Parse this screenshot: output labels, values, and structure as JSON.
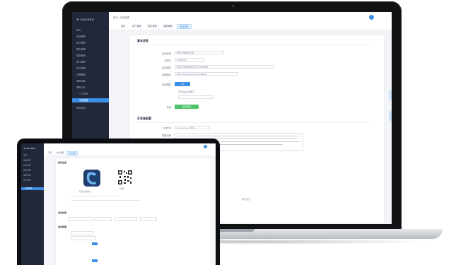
{
  "main_app": {
    "logo_text": "▼ GUOSEN",
    "sidebar": {
      "items": [
        "首页",
        "系统管理",
        "用户管理",
        "角色管理",
        "菜单管理",
        "部门管理",
        "岗位管理",
        "字典管理",
        "参数设置",
        "通知公告"
      ],
      "sub_items": [
        "日志管理"
      ],
      "active_item": "应用管理",
      "after_items": [
        "系统监控"
      ]
    },
    "breadcrumb": "首页 / 应用管理",
    "tabs": [
      {
        "label": "首页"
      },
      {
        "label": "用户管理"
      },
      {
        "label": "角色管理"
      },
      {
        "label": "菜单管理"
      },
      {
        "label": "应用配置"
      }
    ],
    "form": {
      "section1_title": "基本信息",
      "fields": [
        {
          "label": "应用名称",
          "value": "国信证券移动应用"
        },
        {
          "label": "应用ID",
          "value": "10000001"
        },
        {
          "label": "应用描述",
          "value": "国信证券移动端应用平台集成服务"
        },
        {
          "label": "回调地址",
          "value": "https://app.guosen.com/callback"
        }
      ],
      "upload_label": "应用图标",
      "upload_button": "上传",
      "upload_hint": "支持jpg/png格式",
      "status_label": "状态",
      "save_button": "保存配置",
      "section2_title": "开发者配置",
      "key_label": "AppKey",
      "key_value": "gs_app_key_0001",
      "secret_label": "配置说明"
    },
    "footer_hint": "确定提交"
  },
  "front_app": {
    "logo_text": "▼ GUOSEN",
    "sidebar_items": [
      "首页",
      "系统管理",
      "用户管理",
      "角色管理",
      "菜单管理",
      "部门管理"
    ],
    "active_item": "应用管理",
    "tabs": [
      "首页",
      "用户管理",
      "应用配置"
    ],
    "section1_title": "应用信息",
    "section2_title": "应用权限",
    "section3_title": "应用配置",
    "caption": "扫码下载应用",
    "qr_label": "二维码"
  }
}
